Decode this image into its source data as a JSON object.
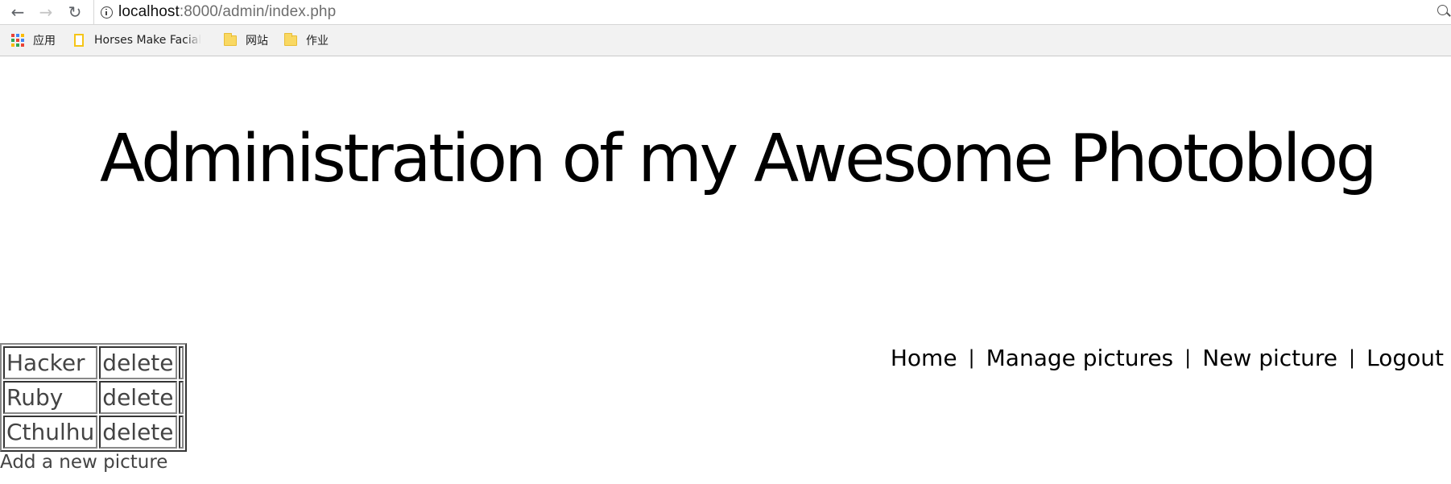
{
  "browser": {
    "url_host": "localhost",
    "url_rest": ":8000/admin/index.php",
    "bookmarks": [
      {
        "label": "应用",
        "icon": "apps-icon"
      },
      {
        "label": "Horses Make Facial",
        "icon": "page-icon"
      },
      {
        "label": "网站",
        "icon": "folder-icon"
      },
      {
        "label": "作业",
        "icon": "folder-icon"
      }
    ]
  },
  "page": {
    "title": "Administration of my Awesome Photoblog",
    "nav": {
      "home": "Home",
      "manage": "Manage pictures",
      "new": "New picture",
      "logout": "Logout",
      "separator": "|"
    },
    "pictures": [
      {
        "name": "Hacker",
        "action": "delete"
      },
      {
        "name": "Ruby",
        "action": "delete"
      },
      {
        "name": "Cthulhu",
        "action": "delete"
      }
    ],
    "add_link": "Add a new picture"
  },
  "colors": {
    "text_dark": "#000000",
    "text_muted": "#444444",
    "bookmarks_bar": "#f2f2f2"
  }
}
